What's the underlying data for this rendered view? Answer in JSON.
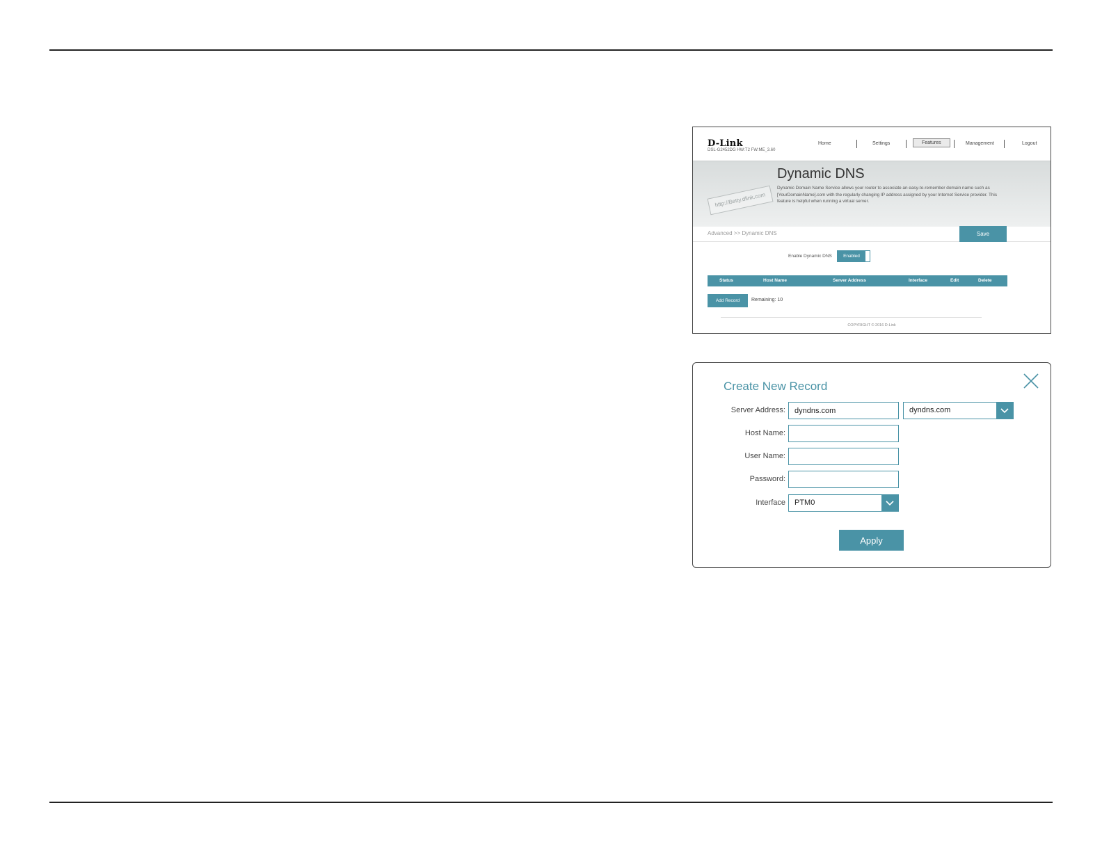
{
  "router_page": {
    "brand": "D-Link",
    "model_info": "DSL-G2452DG   HW:T2   FW:ME_3.60",
    "nav": [
      "Home",
      "Settings",
      "Features",
      "Management",
      "Logout"
    ],
    "active_nav": "Features",
    "banner_art_text": "http://Betty.dlink.com",
    "page_title": "Dynamic DNS",
    "description": "Dynamic Domain Name Service allows your router to associate an easy-to-remember domain name such as [YourDomainName].com with the regularly changing IP address assigned by your Internet Service provider. This feature is helpful when running a virtual server.",
    "breadcrumb": "Advanced >> Dynamic DNS",
    "save_label": "Save",
    "enable_label": "Enable Dynamic DNS",
    "toggle_label": "Enabled",
    "table_headers": [
      "Status",
      "Host Name",
      "Server Address",
      "Interface",
      "Edit",
      "Delete"
    ],
    "add_record_label": "Add Record",
    "remaining": "Remaining: 10",
    "copyright": "COPYRIGHT © 2016 D-Link"
  },
  "modal": {
    "title": "Create New Record",
    "server_address_label": "Server Address:",
    "server_address_value": "dyndns.com",
    "server_select_value": "dyndns.com",
    "host_name_label": "Host Name:",
    "user_name_label": "User Name:",
    "password_label": "Password:",
    "interface_label": "Interface",
    "interface_value": "PTM0",
    "apply_label": "Apply"
  },
  "colors": {
    "accent": "#4a93a6",
    "rule": "#222222"
  }
}
